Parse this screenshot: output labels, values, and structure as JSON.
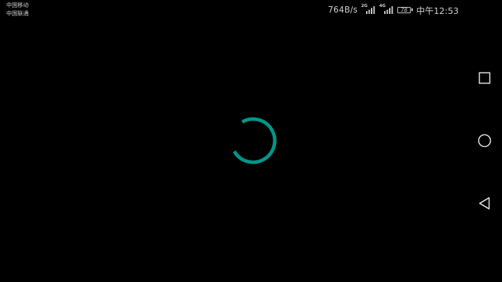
{
  "status_bar": {
    "carrier_1": "中国移动",
    "carrier_2": "中国联通",
    "net_speed": "764B/s",
    "signal_1_tag": "2G",
    "signal_2_tag": "4G",
    "battery_level": "78",
    "time": "中午12:53"
  },
  "loading": {
    "progress_fraction": 0.75
  },
  "colors": {
    "background": "#000000",
    "status_text": "#cfcfcf",
    "spinner": "#009688",
    "nav_icons": "#e0e0e0"
  },
  "navigation": {
    "recents_icon": "square-icon",
    "home_icon": "circle-icon",
    "back_icon": "triangle-back-icon"
  }
}
